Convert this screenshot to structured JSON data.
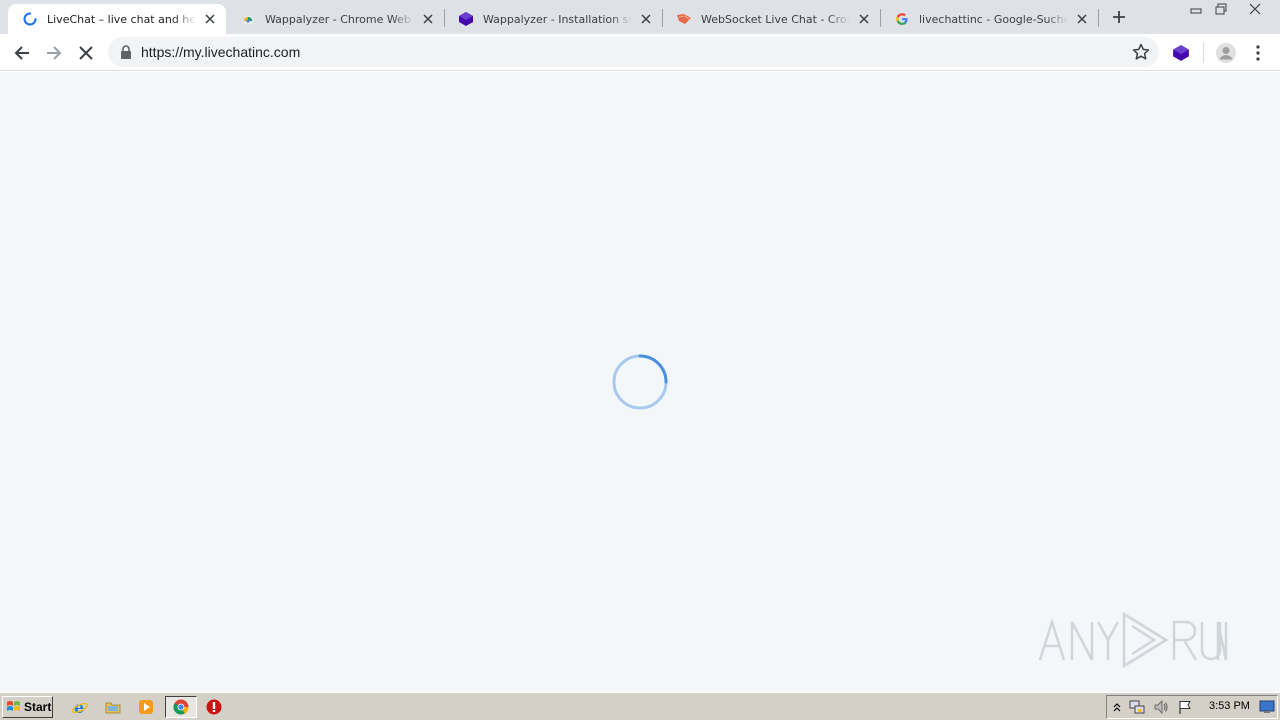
{
  "browser": {
    "tabs": [
      {
        "title": "LiveChat – live chat and help desk software",
        "active": true,
        "favicon": "loading-spinner-icon"
      },
      {
        "title": "Wappalyzer - Chrome Web Store",
        "active": false,
        "favicon": "chrome-web-store-icon"
      },
      {
        "title": "Wappalyzer - Installation successful",
        "active": false,
        "favicon": "wappalyzer-icon"
      },
      {
        "title": "WebSocket Live Chat - Cross-Site",
        "active": false,
        "favicon": "websocket-icon"
      },
      {
        "title": "livechattinc - Google-Suche",
        "active": false,
        "favicon": "google-icon"
      }
    ],
    "address_bar": {
      "url": "https://my.livechatinc.com"
    },
    "icons": {
      "back": "back-arrow-icon",
      "forward": "forward-arrow-icon",
      "stop": "stop-loading-icon",
      "bookmark": "star-icon",
      "extension": "wappalyzer-extension-icon",
      "profile": "profile-avatar-icon",
      "menu": "kebab-menu-icon"
    }
  },
  "page": {
    "state": "loading",
    "spinner": "loading-spinner-icon"
  },
  "watermark": {
    "text": "ANY RUN"
  },
  "taskbar": {
    "start_label": "Start",
    "clock": "3:53 PM",
    "quick_launch": [
      "internet-explorer-icon",
      "folder-icon",
      "media-player-icon",
      "chrome-icon",
      "stop-sign-icon"
    ],
    "tray": [
      "expand-arrow-icon",
      "network-icon",
      "volume-icon",
      "flag-icon",
      "show-desktop-icon"
    ]
  },
  "colors": {
    "accent": "#1a73e8",
    "page_bg": "#f4f7fa",
    "tabstrip_bg": "#dee1e6",
    "taskbar_bg": "#d4d0c8",
    "wappalyzer_purple": "#4608ad"
  }
}
